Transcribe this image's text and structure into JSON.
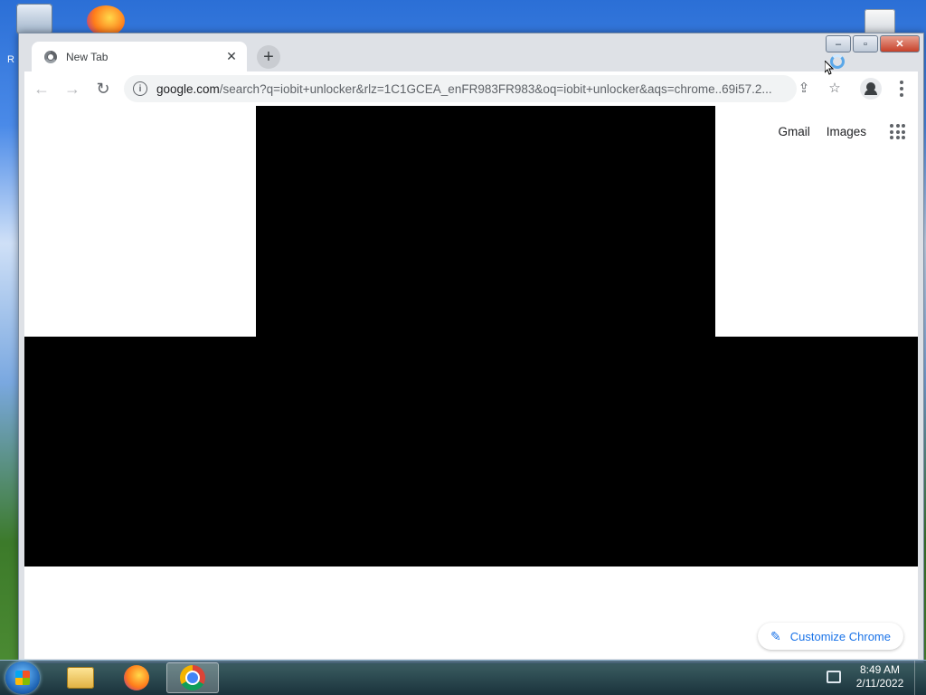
{
  "desktop": {
    "label_fragment": "R"
  },
  "window": {
    "controls": {
      "minimize": "–",
      "maximize": "▫",
      "close": "✕"
    }
  },
  "tab": {
    "title": "New Tab",
    "close_glyph": "✕"
  },
  "toolbar": {
    "back_glyph": "←",
    "forward_glyph": "→",
    "reload_glyph": "↻",
    "new_tab_glyph": "+",
    "url_host": "google.com",
    "url_path": "/search?q=iobit+unlocker&rlz=1C1GCEA_enFR983FR983&oq=iobit+unlocker&aqs=chrome..69i57.2...",
    "share_glyph": "⇪",
    "star_glyph": "☆"
  },
  "page": {
    "links": {
      "gmail": "Gmail",
      "images": "Images"
    },
    "customize_label": "Customize Chrome",
    "pencil_glyph": "✎"
  },
  "taskbar": {
    "apps": [
      "Windows Explorer",
      "Firefox",
      "Google Chrome"
    ],
    "active_app": "Google Chrome",
    "clock_time": "8:49 AM",
    "clock_date": "2/11/2022"
  }
}
